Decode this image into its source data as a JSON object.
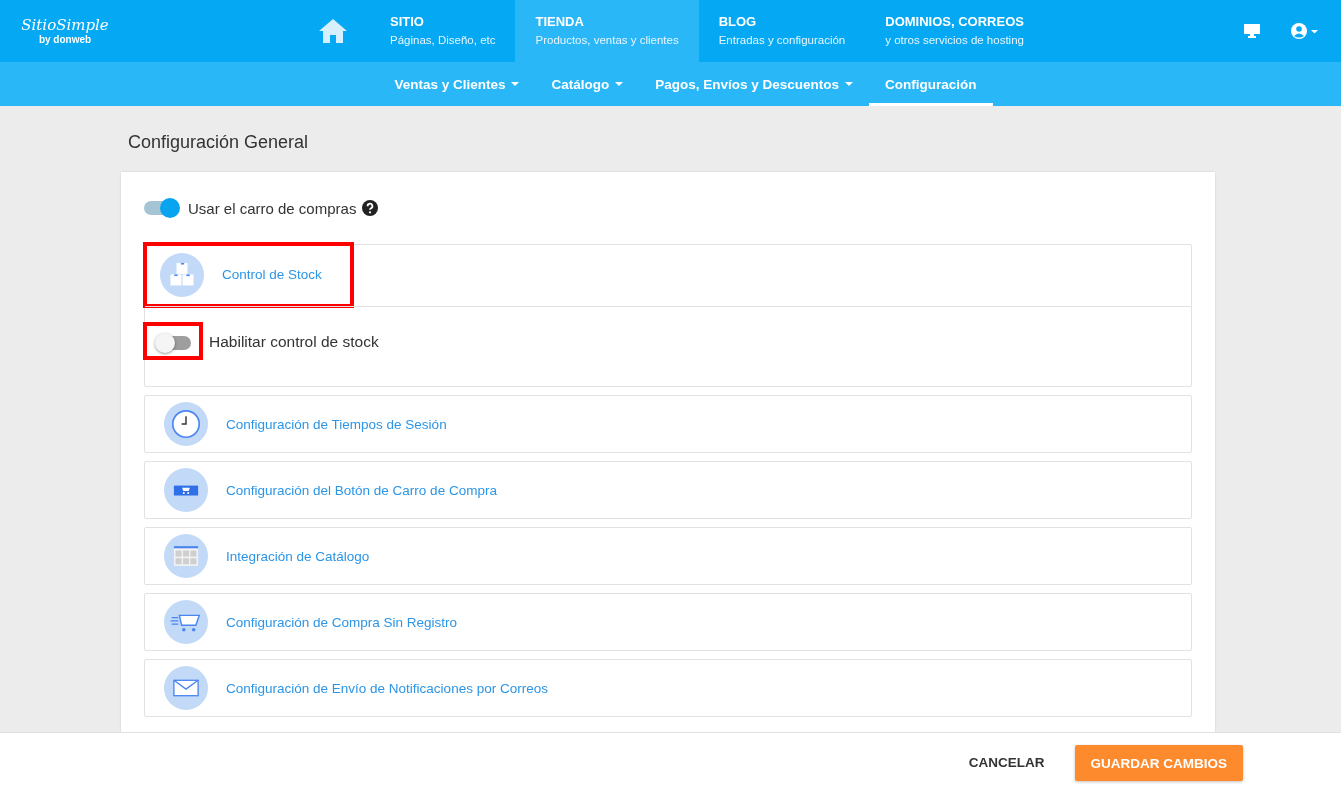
{
  "header": {
    "logo": {
      "name": "SitioSimple",
      "byline": "by donweb"
    },
    "nav": [
      {
        "title": "SITIO",
        "subtitle": "Páginas, Diseño, etc",
        "selected": false
      },
      {
        "title": "TIENDA",
        "subtitle": "Productos, ventas y clientes",
        "selected": true
      },
      {
        "title": "BLOG",
        "subtitle": "Entradas y configuración",
        "selected": false
      },
      {
        "title": "DOMINIOS, CORREOS",
        "subtitle": "y otros servicios de hosting",
        "selected": false
      }
    ]
  },
  "subnav": [
    {
      "label": "Ventas y Clientes",
      "dropdown": true,
      "selected": false
    },
    {
      "label": "Catálogo",
      "dropdown": true,
      "selected": false
    },
    {
      "label": "Pagos, Envíos y Descuentos",
      "dropdown": true,
      "selected": false
    },
    {
      "label": "Configuración",
      "dropdown": false,
      "selected": true
    }
  ],
  "page_title": "Configuración General",
  "cart_toggle": {
    "label": "Usar el carro de compras",
    "on": true
  },
  "sections": [
    {
      "kind": "boxes",
      "title": "Control de Stock",
      "highlighted": true,
      "expanded": true,
      "option": {
        "label": "Habilitar control de stock",
        "on": false,
        "highlighted": true
      }
    },
    {
      "kind": "clock",
      "title": "Configuración de Tiempos de Sesión",
      "highlighted": false,
      "expanded": false
    },
    {
      "kind": "cart-button",
      "title": "Configuración del Botón de Carro de Compra",
      "highlighted": false,
      "expanded": false
    },
    {
      "kind": "grid",
      "title": "Integración de Catálogo",
      "highlighted": false,
      "expanded": false
    },
    {
      "kind": "fast-cart",
      "title": "Configuración de Compra Sin Registro",
      "highlighted": false,
      "expanded": false
    },
    {
      "kind": "envelope",
      "title": "Configuración de Envío de Notificaciones por Correos",
      "highlighted": false,
      "expanded": false
    }
  ],
  "footer": {
    "buttons": [
      {
        "label": "CANCELAR",
        "kind": "flat"
      },
      {
        "label": "GUARDAR CAMBIOS",
        "kind": "primary"
      }
    ]
  }
}
